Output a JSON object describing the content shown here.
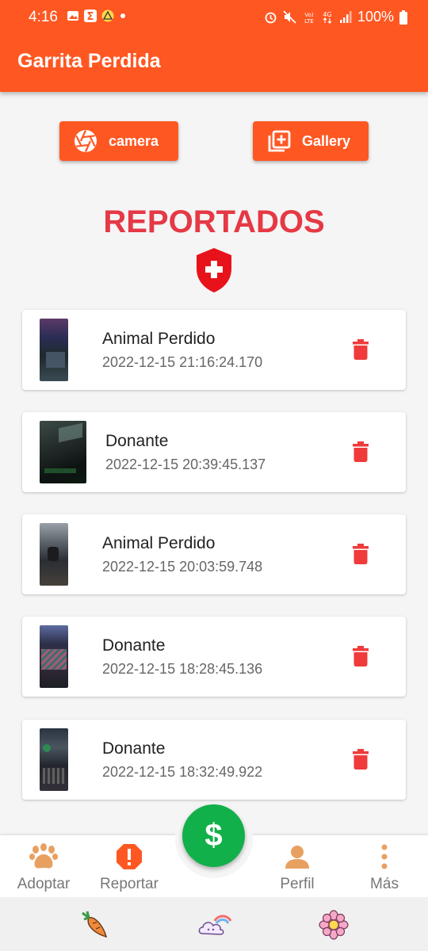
{
  "status_bar": {
    "time": "4:16",
    "battery": "100%",
    "notification_icons": [
      "gallery-icon",
      "sigma-icon",
      "warning-icon",
      "dot-icon"
    ],
    "system_icons": [
      "alarm-icon",
      "mute-icon",
      "volte-icon",
      "4g-icon",
      "signal-icon",
      "battery-icon"
    ]
  },
  "app_bar": {
    "title": "Garrita Perdida"
  },
  "actions": {
    "camera_label": "camera",
    "gallery_label": "Gallery"
  },
  "heading": "REPORTADOS",
  "reports": [
    {
      "name": "Animal Perdido",
      "date": "2022-12-15 21:16:24.170"
    },
    {
      "name": "Donante",
      "date": "2022-12-15 20:39:45.137"
    },
    {
      "name": "Animal Perdido",
      "date": "2022-12-15 20:03:59.748"
    },
    {
      "name": "Donante",
      "date": "2022-12-15 18:28:45.136"
    },
    {
      "name": "Donante",
      "date": "2022-12-15 18:32:49.922"
    }
  ],
  "fab": {
    "symbol": "$"
  },
  "bottom_nav": {
    "adoptar": "Adoptar",
    "reportar": "Reportar",
    "perfil": "Perfil",
    "mas": "Más"
  },
  "colors": {
    "primary": "#ff5722",
    "heading": "#e53945",
    "fab": "#12b04a",
    "trash": "#ef3b3b"
  }
}
